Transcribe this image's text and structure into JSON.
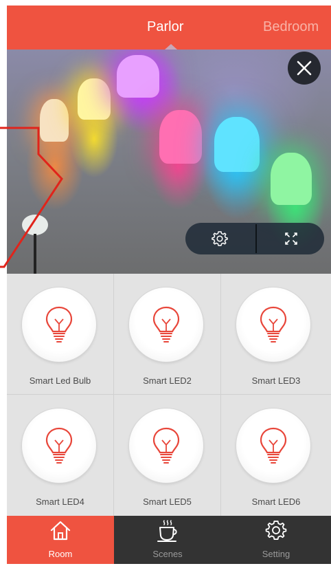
{
  "header": {
    "tabs": [
      {
        "label": "Parlor",
        "active": true
      },
      {
        "label": "Bedroom",
        "active": false
      }
    ]
  },
  "camera": {
    "icons": {
      "close": "close-icon",
      "settings": "gear-icon",
      "fullscreen": "fullscreen-icon"
    }
  },
  "devices": [
    {
      "label": "Smart Led Bulb",
      "icon": "lightbulb-icon"
    },
    {
      "label": "Smart LED2",
      "icon": "lightbulb-icon"
    },
    {
      "label": "Smart LED3",
      "icon": "lightbulb-icon"
    },
    {
      "label": "Smart LED4",
      "icon": "lightbulb-icon"
    },
    {
      "label": "Smart LED5",
      "icon": "lightbulb-icon"
    },
    {
      "label": "Smart LED6",
      "icon": "lightbulb-icon"
    }
  ],
  "bottom_nav": {
    "items": [
      {
        "label": "Room",
        "icon": "home-icon",
        "active": true
      },
      {
        "label": "Scenes",
        "icon": "coffee-cup-icon",
        "active": false
      },
      {
        "label": "Setting",
        "icon": "gear-icon",
        "active": false
      }
    ]
  },
  "colors": {
    "accent": "#ef5340",
    "nav_bg": "#333333",
    "grid_bg": "#e3e3e3",
    "callout": "#e0241b"
  }
}
